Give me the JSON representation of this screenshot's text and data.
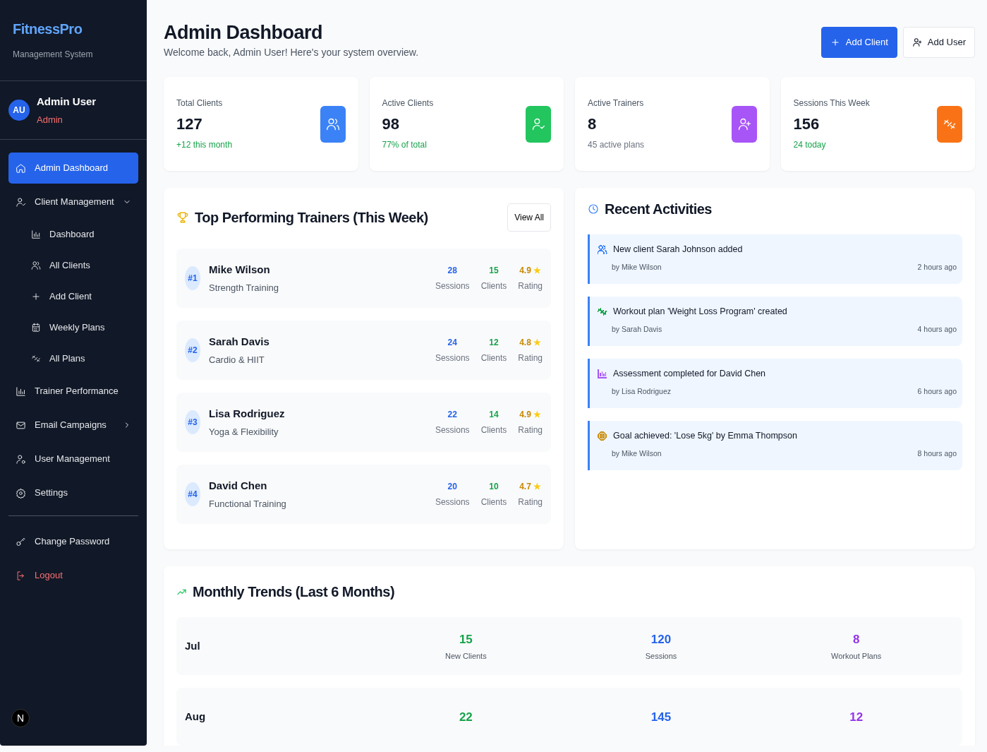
{
  "brand": {
    "title": "FitnessPro",
    "subtitle": "Management System"
  },
  "user": {
    "initials": "AU",
    "name": "Admin User",
    "role": "Admin"
  },
  "nav": [
    {
      "label": "Admin Dashboard",
      "selected": true,
      "kind": "link"
    },
    {
      "label": "Client Management",
      "selected": false,
      "kind": "group",
      "expanded": true,
      "children": [
        {
          "label": "Dashboard",
          "selected": false
        },
        {
          "label": "All Clients",
          "selected": false
        },
        {
          "label": "Add Client",
          "selected": false
        },
        {
          "label": "Weekly Plans",
          "selected": false
        },
        {
          "label": "All Plans",
          "selected": false
        }
      ]
    },
    {
      "label": "Trainer Performance",
      "selected": false,
      "kind": "link"
    },
    {
      "label": "Email Campaigns",
      "selected": false,
      "kind": "group",
      "expanded": false
    },
    {
      "label": "User Management",
      "selected": false,
      "kind": "link"
    },
    {
      "label": "Settings",
      "selected": false,
      "kind": "link"
    }
  ],
  "nav_footer": [
    {
      "label": "Change Password",
      "kind": "normal"
    },
    {
      "label": "Logout",
      "kind": "danger"
    }
  ],
  "dev_badge": "N",
  "header": {
    "title": "Admin Dashboard",
    "subtitle": "Welcome back, Admin User! Here's your system overview.",
    "actions": [
      {
        "label": "Add Client",
        "kind": "primary"
      },
      {
        "label": "Add User",
        "kind": "outline"
      }
    ]
  },
  "stats": [
    {
      "label": "Total Clients",
      "value": "127",
      "note": "+12 this month",
      "positive": true,
      "color": "#3b82f6"
    },
    {
      "label": "Active Clients",
      "value": "98",
      "note": "77% of total",
      "positive": true,
      "color": "#22c55e"
    },
    {
      "label": "Active Trainers",
      "value": "8",
      "note": "45 active plans",
      "positive": false,
      "color": "#a855f7"
    },
    {
      "label": "Sessions This Week",
      "value": "156",
      "note": "24 today",
      "positive": true,
      "color": "#f97316"
    }
  ],
  "trainers": {
    "title": "Top Performing Trainers (This Week)",
    "button": "View All",
    "items": [
      {
        "rank": "#1",
        "name": "Mike Wilson",
        "specialty": "Strength Training",
        "metrics": [
          {
            "value": "28",
            "label": "Sessions",
            "kind": "sessions"
          },
          {
            "value": "15",
            "label": "Clients",
            "kind": "clients"
          },
          {
            "value": "4.9",
            "star": "★",
            "label": "Rating",
            "kind": "rating"
          }
        ]
      },
      {
        "rank": "#2",
        "name": "Sarah Davis",
        "specialty": "Cardio & HIIT",
        "metrics": [
          {
            "value": "24",
            "label": "Sessions",
            "kind": "sessions"
          },
          {
            "value": "12",
            "label": "Clients",
            "kind": "clients"
          },
          {
            "value": "4.8",
            "star": "★",
            "label": "Rating",
            "kind": "rating"
          }
        ]
      },
      {
        "rank": "#3",
        "name": "Lisa Rodriguez",
        "specialty": "Yoga & Flexibility",
        "metrics": [
          {
            "value": "22",
            "label": "Sessions",
            "kind": "sessions"
          },
          {
            "value": "14",
            "label": "Clients",
            "kind": "clients"
          },
          {
            "value": "4.9",
            "star": "★",
            "label": "Rating",
            "kind": "rating"
          }
        ]
      },
      {
        "rank": "#4",
        "name": "David Chen",
        "specialty": "Functional Training",
        "metrics": [
          {
            "value": "20",
            "label": "Sessions",
            "kind": "sessions"
          },
          {
            "value": "10",
            "label": "Clients",
            "kind": "clients"
          },
          {
            "value": "4.7",
            "star": "★",
            "label": "Rating",
            "kind": "rating"
          }
        ]
      }
    ]
  },
  "activities": {
    "title": "Recent Activities",
    "items": [
      {
        "text": "New client Sarah Johnson added",
        "by": "by Mike Wilson",
        "time": "2 hours ago",
        "kind": "client",
        "color": "#3b82f6"
      },
      {
        "text": "Workout plan 'Weight Loss Program' created",
        "by": "by Sarah Davis",
        "time": "4 hours ago",
        "kind": "plan",
        "color": "#16a34a"
      },
      {
        "text": "Assessment completed for David Chen",
        "by": "by Lisa Rodriguez",
        "time": "6 hours ago",
        "kind": "assessment",
        "color": "#a855f7"
      },
      {
        "text": "Goal achieved: 'Lose 5kg' by Emma Thompson",
        "by": "by Mike Wilson",
        "time": "8 hours ago",
        "kind": "goal",
        "color": "#ca8a04"
      }
    ]
  },
  "trends": {
    "title": "Monthly Trends (Last 6 Months)",
    "rows": [
      {
        "month": "Jul",
        "metrics": [
          {
            "value": "15",
            "label": "New Clients",
            "kind": "clients"
          },
          {
            "value": "120",
            "label": "Sessions",
            "kind": "sessions"
          },
          {
            "value": "8",
            "label": "Workout Plans",
            "kind": "plans"
          }
        ]
      },
      {
        "month": "Aug",
        "metrics": [
          {
            "value": "22",
            "kind": "clients"
          },
          {
            "value": "145",
            "kind": "sessions"
          },
          {
            "value": "12",
            "kind": "plans"
          }
        ]
      }
    ]
  }
}
